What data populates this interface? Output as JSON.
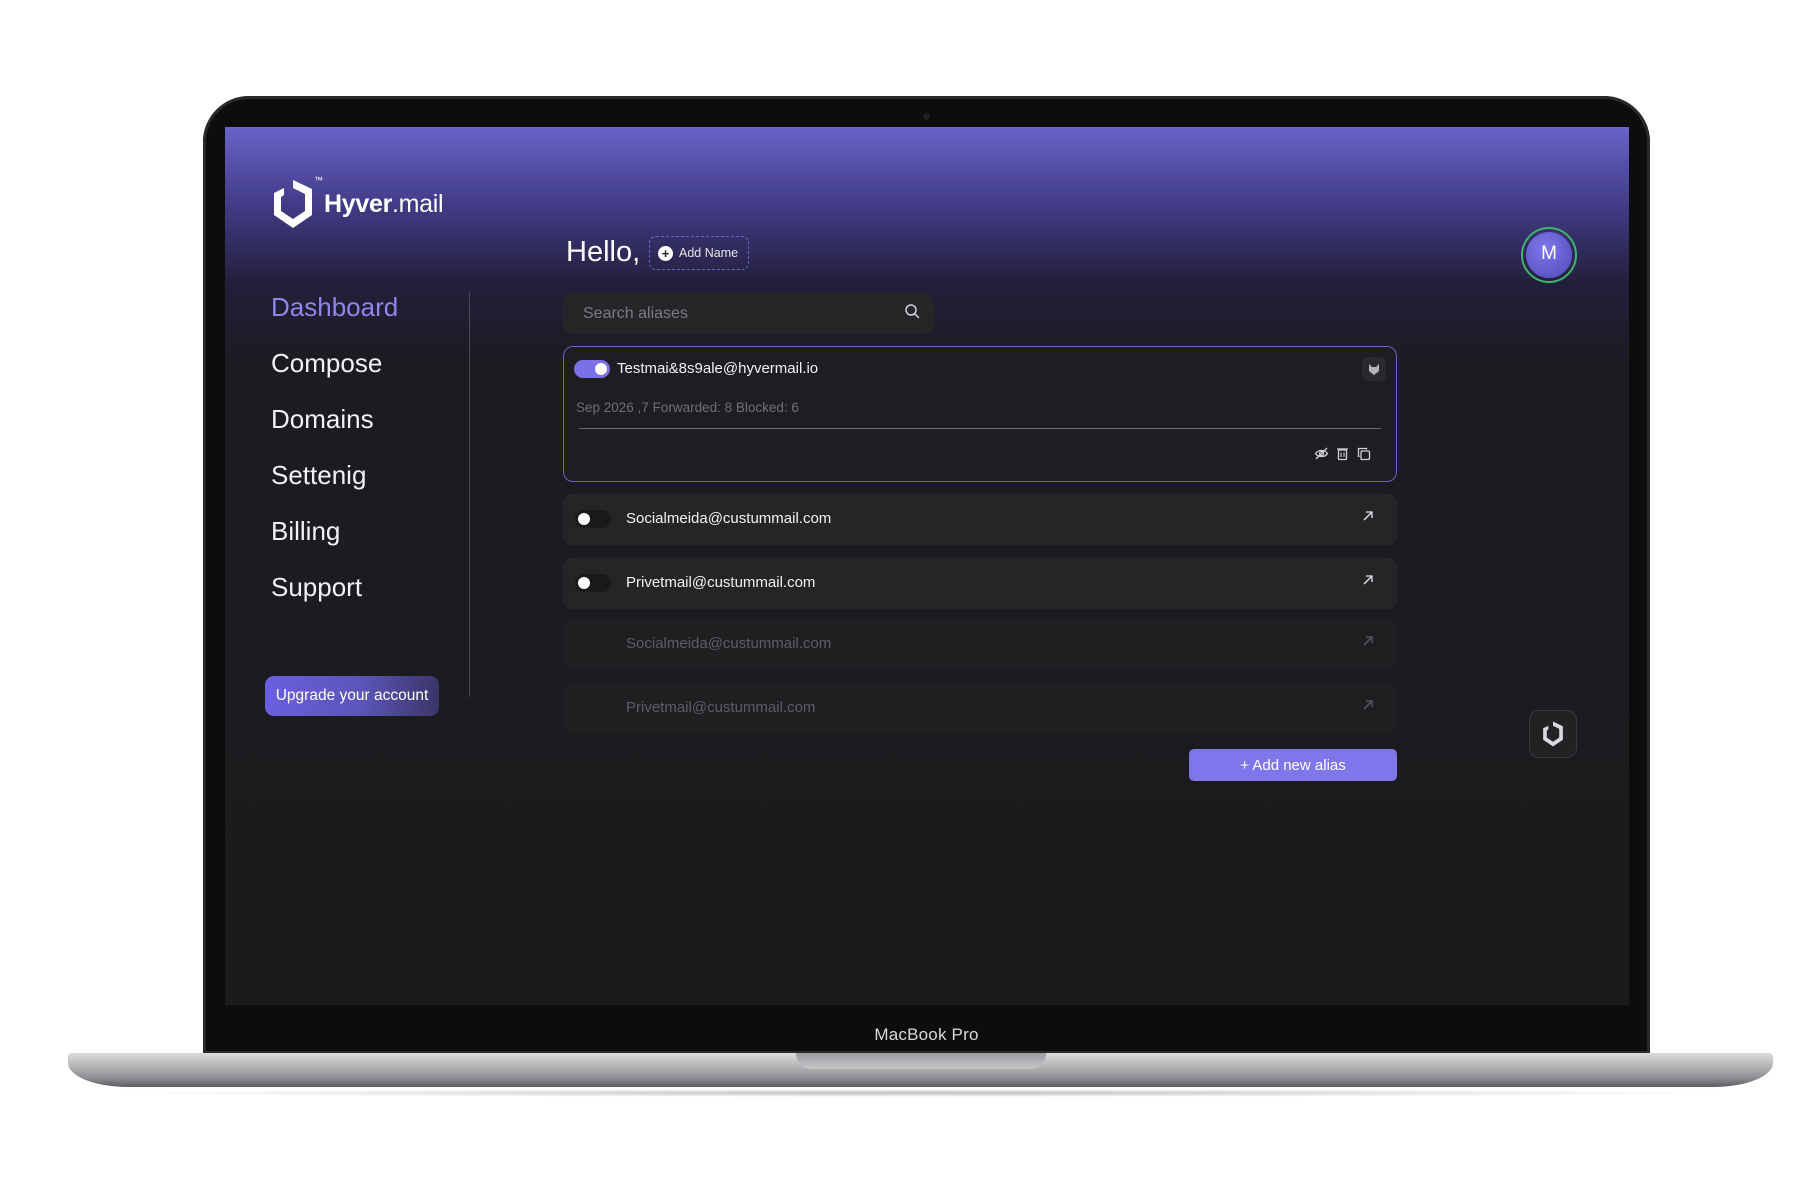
{
  "device": {
    "model_label": "MacBook Pro"
  },
  "brand": {
    "name_bold": "Hyver",
    "name_light": ".mail",
    "trademark": "™",
    "accent_color": "#7f76ec"
  },
  "greeting": {
    "text": "Hello,",
    "add_name_label": "Add Name"
  },
  "sidebar": {
    "items": [
      {
        "label": "Dashboard",
        "active": true
      },
      {
        "label": "Compose"
      },
      {
        "label": "Domains"
      },
      {
        "label": "Settenig"
      },
      {
        "label": "Billing"
      },
      {
        "label": "Support"
      }
    ],
    "upgrade_label": "Upgrade your account"
  },
  "search": {
    "placeholder": "Search aliases",
    "value": ""
  },
  "aliases": {
    "expanded": {
      "email": "Testmai&8s9ale@hyvermail.io",
      "enabled": true,
      "meta": "Sep 2026 ,7 Forwarded: 8 Blocked: 6"
    },
    "rows": [
      {
        "email": "Socialmeida@custummail.com",
        "enabled": false
      },
      {
        "email": "Privetmail@custummail.com",
        "enabled": false
      },
      {
        "email": "Socialmeida@custummail.com"
      },
      {
        "email": "Privetmail@custummail.com"
      }
    ]
  },
  "add_alias_label": "+  Add new alias",
  "profile": {
    "initial": "M",
    "ring_color": "#3fb46a"
  }
}
